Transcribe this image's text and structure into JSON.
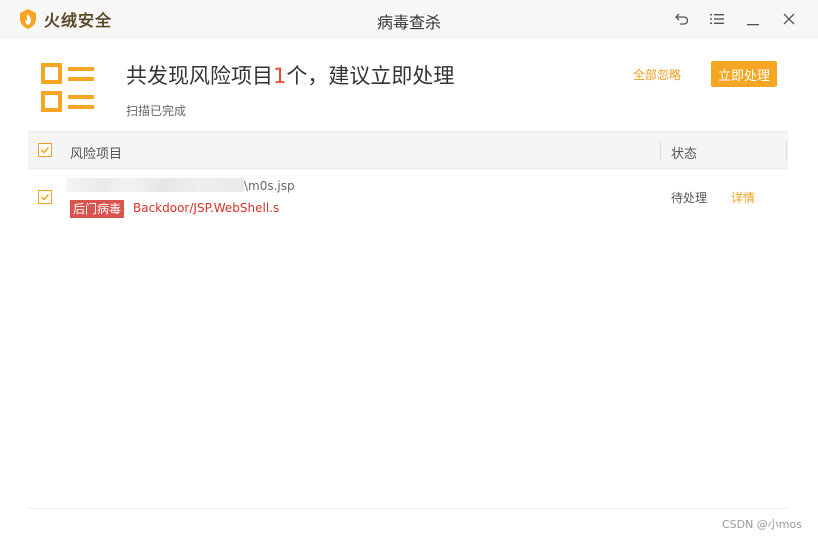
{
  "app": {
    "brand": "火绒安全",
    "window_title": "病毒查杀",
    "brand_color": "#f6a623",
    "icons": {
      "logo": "flame-shield-icon",
      "back": "undo-icon",
      "menu": "menu-icon",
      "minimize": "minimize-icon",
      "close": "close-icon"
    }
  },
  "summary": {
    "title_prefix": "共发现风险项目",
    "count": "1",
    "title_suffix": "个，建议立即处理",
    "subtitle": "扫描已完成",
    "ignore_all": "全部忽略",
    "handle_now": "立即处理",
    "icon": "risk-list-icon"
  },
  "table": {
    "columns": {
      "item": "风险项目",
      "status": "状态"
    },
    "rows": [
      {
        "path_suffix": "\\m0s.jsp",
        "tag": "后门病毒",
        "virus_name": "Backdoor/JSP.WebShell.s",
        "status": "待处理",
        "action": "详情",
        "checked": true
      }
    ]
  },
  "footer": {
    "watermark": "CSDN @小mos"
  }
}
